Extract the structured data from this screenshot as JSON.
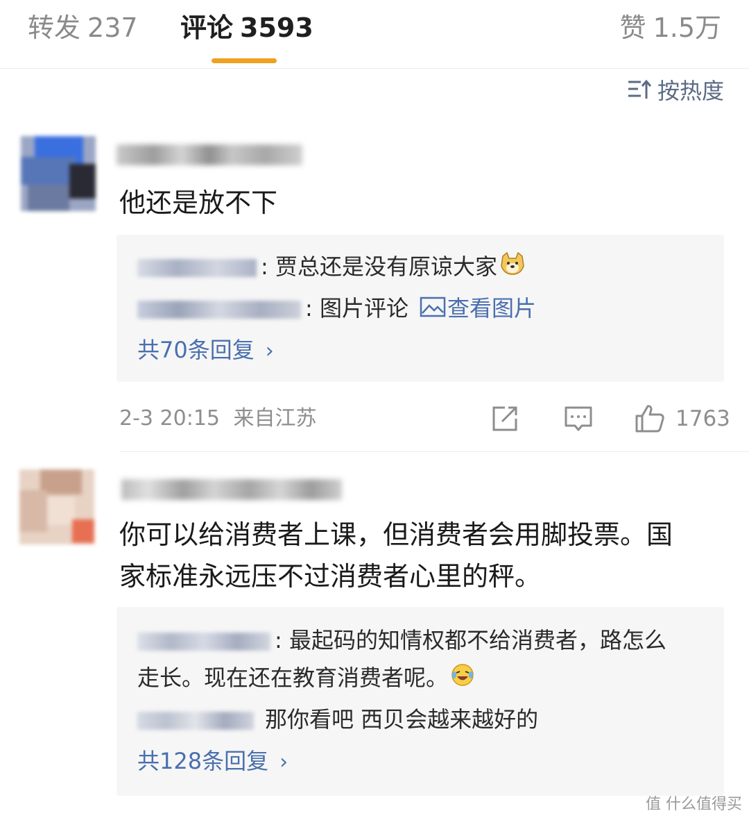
{
  "tabs": {
    "repost": {
      "label": "转发",
      "count": "237"
    },
    "comments": {
      "label": "评论",
      "count": "3593"
    },
    "likes": {
      "label": "赞",
      "count": "1.5万"
    }
  },
  "sort": {
    "label": "按热度",
    "icon": "sort-icon"
  },
  "colors": {
    "accent": "#f0a121",
    "link": "#4a6fae"
  },
  "comments": [
    {
      "text": "他还是放不下",
      "replies": [
        {
          "text": ": 贾总还是没有原谅大家",
          "emoji": "doge-emoji"
        },
        {
          "text": ": 图片评论",
          "link": "查看图片",
          "link_icon": "image-icon"
        }
      ],
      "more_replies": "共70条回复",
      "time": "2-3 20:15",
      "location": "来自江苏",
      "likes": "1763"
    },
    {
      "text_lines": [
        "你可以给消费者上课，但消费者会用脚投票。国",
        "家标准永远压不过消费者心里的秤。"
      ],
      "replies": [
        {
          "text_lines": [
            ": 最起码的知情权都不给消费者，路怎么",
            "走长。现在还在教育消费者呢。"
          ],
          "emoji": "laugh-cry-emoji"
        },
        {
          "text": "那你看吧 西贝会越来越好的"
        }
      ],
      "more_replies": "共128条回复"
    }
  ],
  "watermark": {
    "text": "值 什么值得买"
  }
}
